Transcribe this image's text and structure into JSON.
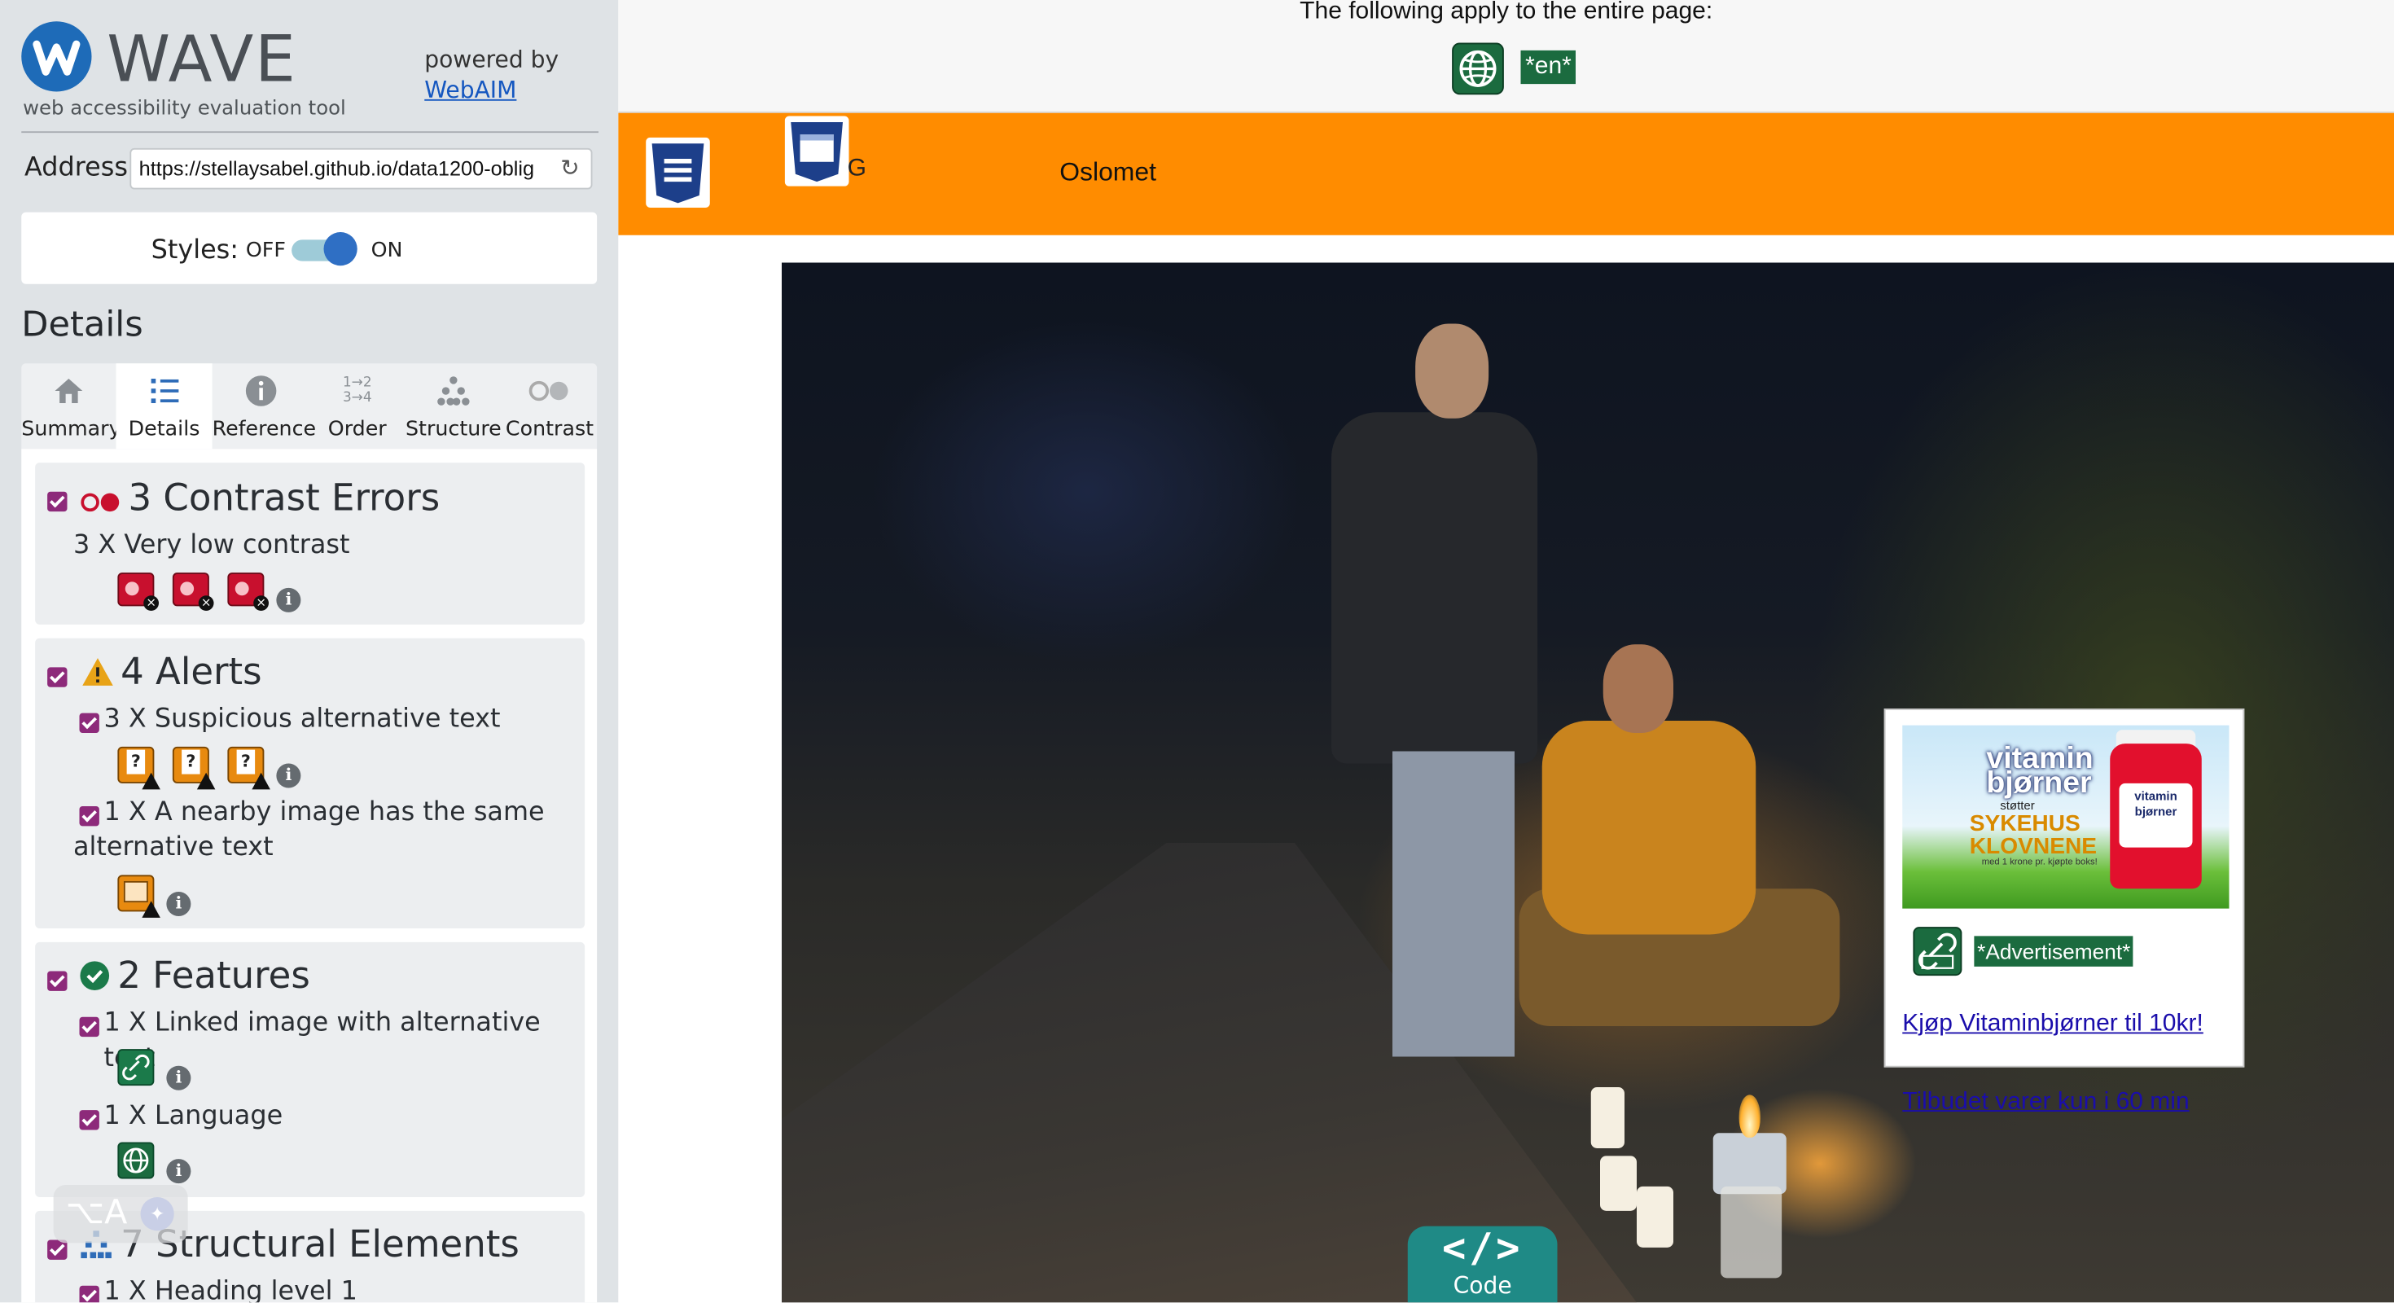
{
  "app": {
    "logo_word": "WAVE",
    "tagline": "web accessibility evaluation tool",
    "powered_by": "powered by",
    "powered_link": "WebAIM"
  },
  "address": {
    "label": "Address:",
    "value": "https://stellaysabel.github.io/data1200-oblig"
  },
  "styles": {
    "label": "Styles:",
    "off": "OFF",
    "on": "ON",
    "enabled": true
  },
  "details_heading": "Details",
  "tabs": [
    {
      "label": "Summary",
      "icon": "home-icon"
    },
    {
      "label": "Details",
      "icon": "list-icon",
      "active": true
    },
    {
      "label": "Reference",
      "icon": "info-icon"
    },
    {
      "label": "Order",
      "icon": "order-icon",
      "glyph_top": "1→2",
      "glyph_bottom": "3→4"
    },
    {
      "label": "Structure",
      "icon": "structure-icon"
    },
    {
      "label": "Contrast",
      "icon": "contrast-icon"
    }
  ],
  "sections": {
    "contrast": {
      "title": "3 Contrast Errors",
      "item": "3 X Very low contrast"
    },
    "alerts": {
      "title": "4 Alerts",
      "item1": "3 X Suspicious alternative text",
      "item2": "1 X A nearby image has the same alternative text"
    },
    "features": {
      "title": "2 Features",
      "item1": "1 X Linked image with alternative text",
      "item2": "1 X Language"
    },
    "structure": {
      "title": "7 Structural Elements",
      "item1": "1 X Heading level 1"
    }
  },
  "info_glyph": "i",
  "floating_widget": {
    "text": "⌥A"
  },
  "page": {
    "top_text": "The following apply to the entire page:",
    "lang_tag": "*en*",
    "nav_partial": "G",
    "nav_oslomet": "Oslomet",
    "ad": {
      "img_title_line1": "vitamin",
      "img_title_line2": "bjørner",
      "img_sub": "støtter",
      "img_big_line1": "SYKEHUS",
      "img_big_line2": "KLOVNENE",
      "img_small": "med 1 krone pr. kjøpte boks!",
      "bottle_text": "vitamin bjørner",
      "tag": "*Advertisement*",
      "link": "Kjøp Vitaminbjørner til 10kr!"
    },
    "offer_link": "Tilbudet varer kun i 60 min",
    "code_glyph": "</>",
    "code_label": "Code"
  },
  "colors": {
    "wave_blue": "#1e6bb8",
    "orange_bar": "#ff8c00",
    "error_red": "#c8102e",
    "alert_orange": "#e88a0f",
    "feature_green": "#1b6b3f",
    "checkbox_purple": "#8d2a7a",
    "code_teal": "#1f8a86"
  }
}
